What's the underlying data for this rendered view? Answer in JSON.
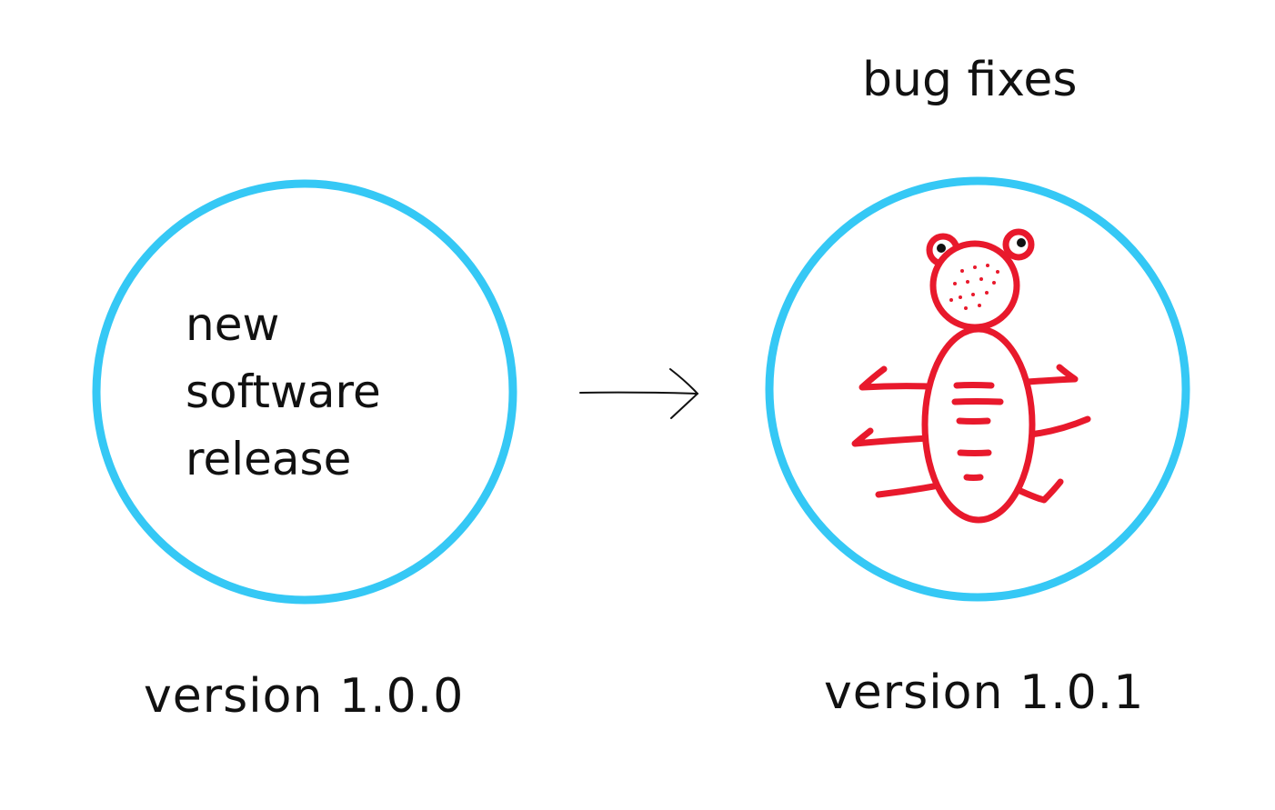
{
  "diagram": {
    "colors": {
      "circle": "#35c8f5",
      "bug": "#e8192c",
      "text": "#111111",
      "background": "#ffffff"
    },
    "left_node": {
      "lines": [
        "new",
        "software",
        "release"
      ],
      "caption": "version 1.0.0"
    },
    "right_node": {
      "heading": "bug fixes",
      "icon": "bug-icon",
      "caption": "version 1.0.1"
    },
    "connector": {
      "icon": "arrow-right-icon"
    }
  }
}
